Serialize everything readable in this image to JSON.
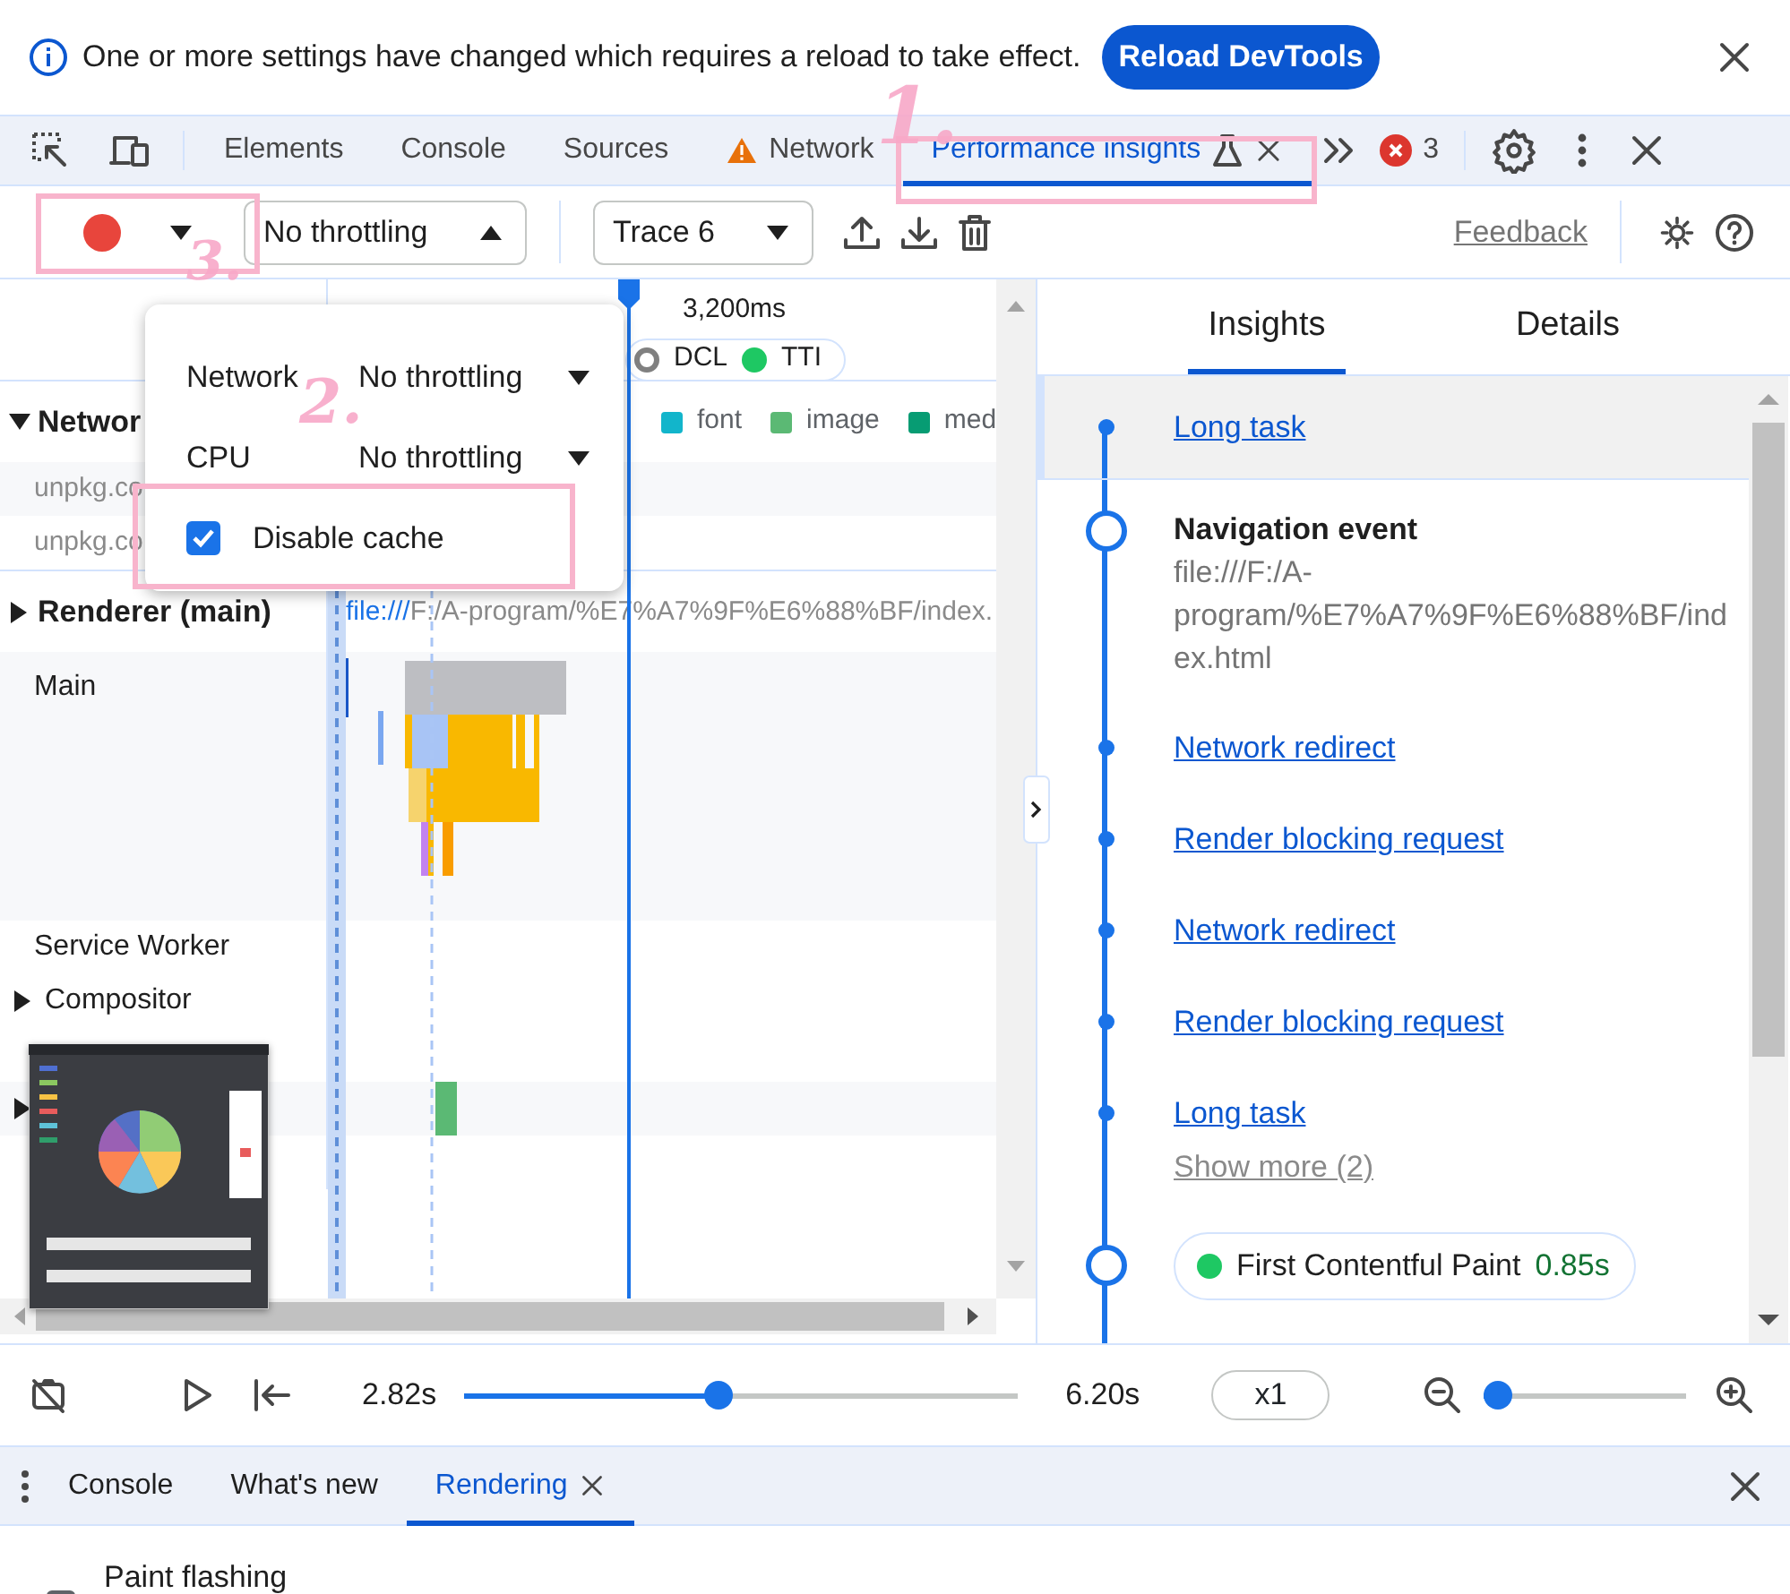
{
  "infobar": {
    "message": "One or more settings have changed which requires a reload to take effect.",
    "button": "Reload DevTools"
  },
  "tabs": [
    {
      "label": "Elements",
      "selected": false,
      "warning": false,
      "experimental": false,
      "closable": false
    },
    {
      "label": "Console",
      "selected": false,
      "warning": false,
      "experimental": false,
      "closable": false
    },
    {
      "label": "Sources",
      "selected": false,
      "warning": false,
      "experimental": false,
      "closable": false
    },
    {
      "label": "Network",
      "selected": false,
      "warning": true,
      "experimental": false,
      "closable": false
    },
    {
      "label": "Performance insights",
      "selected": true,
      "warning": false,
      "experimental": true,
      "closable": true,
      "annotated": true
    }
  ],
  "error_count": "3",
  "toolbar": {
    "record_annotated": true,
    "throttling": "No throttling",
    "trace": "Trace 6",
    "feedback": "Feedback"
  },
  "throttle_menu": {
    "rows": [
      {
        "label": "Network",
        "value": "No throttling"
      },
      {
        "label": "CPU",
        "value": "No throttling"
      }
    ],
    "disable_cache": {
      "label": "Disable cache",
      "checked": true,
      "annotated": true
    }
  },
  "timeline": {
    "ruler": "3,200ms",
    "markers": [
      {
        "label": "DCL",
        "color": "#808080"
      },
      {
        "label": "TTI",
        "color": "#1ec863"
      }
    ],
    "legend": [
      {
        "label": "font",
        "color": "#12b5cb"
      },
      {
        "label": "image",
        "color": "#5bb974"
      },
      {
        "label": "med",
        "color": "#079c73"
      }
    ],
    "tracks": [
      {
        "kind": "section",
        "label": "Networ",
        "expanded": true
      },
      {
        "kind": "request",
        "label": "unpkg.co"
      },
      {
        "kind": "request",
        "label": "unpkg.co"
      },
      {
        "kind": "section",
        "label": "Renderer (main)",
        "expanded": false,
        "url_scheme": "file:///",
        "url_path": "F:/A-program/%E7%A7%9F%E6%88%BF/index."
      },
      {
        "kind": "flame",
        "label": "Main"
      },
      {
        "kind": "thread",
        "label": "Service Worker"
      },
      {
        "kind": "group",
        "label": "Compositor",
        "expanded": false
      },
      {
        "kind": "blank"
      },
      {
        "kind": "group",
        "expanded": false
      },
      {
        "kind": "blank"
      }
    ]
  },
  "insights": {
    "tabs": [
      {
        "label": "Insights",
        "selected": true
      },
      {
        "label": "Details",
        "selected": false
      }
    ],
    "items": [
      {
        "kind": "link",
        "label": "Long task",
        "highlighted": true
      },
      {
        "kind": "event",
        "title": "Navigation event",
        "url": "file:///F:/A-program/%E7%A7%9F%E6%88%BF/index.html"
      },
      {
        "kind": "link",
        "label": "Network redirect",
        "highlighted": false
      },
      {
        "kind": "link",
        "label": "Render blocking request",
        "highlighted": false
      },
      {
        "kind": "link",
        "label": "Network redirect",
        "highlighted": false
      },
      {
        "kind": "link",
        "label": "Render blocking request",
        "highlighted": false
      },
      {
        "kind": "link",
        "label": "Long task",
        "highlighted": false
      },
      {
        "kind": "more",
        "label": "Show more (2)"
      },
      {
        "kind": "metric",
        "label": "First Contentful Paint",
        "value": "0.85s",
        "color": "#1ec863"
      }
    ]
  },
  "player": {
    "start": "2.82s",
    "end": "6.20s",
    "level": 0.46,
    "speed": "x1",
    "zoom": {
      "level": 0.07
    }
  },
  "drawer": {
    "tabs": [
      {
        "label": "Console",
        "selected": false,
        "closable": false
      },
      {
        "label": "What's new",
        "selected": false,
        "closable": false
      },
      {
        "label": "Rendering",
        "selected": true,
        "closable": true
      }
    ],
    "options": [
      {
        "label": "Paint flashing",
        "checked": false
      }
    ]
  },
  "annotations": [
    {
      "label": "1."
    },
    {
      "label": "2."
    },
    {
      "label": "3."
    }
  ]
}
